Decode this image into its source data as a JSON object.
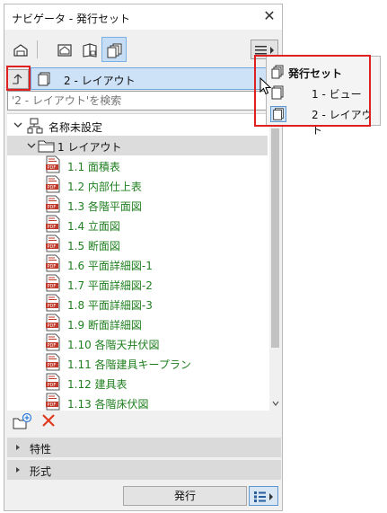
{
  "window": {
    "title": "ナビゲータ - 発行セット",
    "close_glyph": "✕"
  },
  "selector": {
    "current": "2 - レイアウト"
  },
  "search": {
    "placeholder": "'2 - レイアウト'を検索"
  },
  "tree": {
    "root": "名称未設定",
    "folder": "1 レイアウト",
    "items": [
      "1.1 面積表",
      "1.2 内部仕上表",
      "1.3 各階平面図",
      "1.4 立面図",
      "1.5 断面図",
      "1.6 平面詳細図-1",
      "1.7 平面詳細図-2",
      "1.8 平面詳細図-3",
      "1.9 断面詳細図",
      "1.10 各階天井伏図",
      "1.11 各階建具キープラン",
      "1.12 建具表",
      "1.13 各階床伏図"
    ]
  },
  "sections": {
    "properties": "特性",
    "format": "形式"
  },
  "bottom": {
    "publish": "発行"
  },
  "popup": {
    "items": [
      "発行セット",
      "1 - ビュー",
      "2 - レイアウト"
    ],
    "selected": 2
  },
  "colors": {
    "item_text": "#1f7f1f",
    "highlight_red": "#e02020",
    "selection_blue": "#cde1f7",
    "pdf_red": "#c0392b"
  },
  "icons": {
    "toolbar": [
      "project-map-icon",
      "view-map-icon",
      "layout-book-icon",
      "publisher-sets-icon"
    ],
    "list": "pdf-file-icon"
  }
}
